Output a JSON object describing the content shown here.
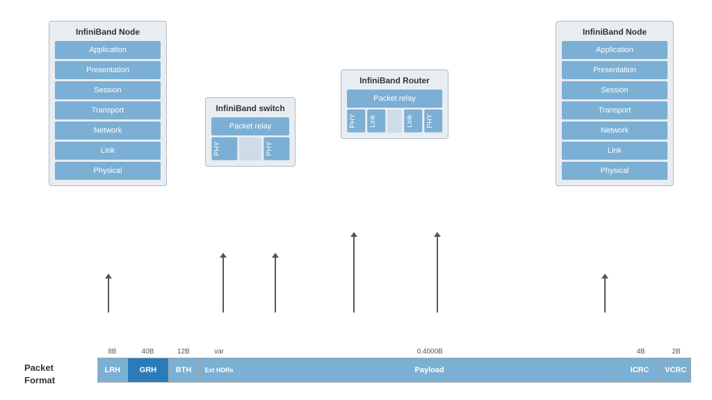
{
  "leftNode": {
    "title": "InfiniBand Node",
    "layers": [
      "Application",
      "Presentation",
      "Session",
      "Transport",
      "Network",
      "Link",
      "Physical"
    ]
  },
  "switch": {
    "title": "InfiniBand switch",
    "relayLabel": "Packet relay",
    "phyLabels": [
      "PHY",
      "PHY"
    ]
  },
  "router": {
    "title": "InfiniBand Router",
    "relayLabel": "Packet relay",
    "phyLabels": [
      "PHY",
      "PHY"
    ],
    "linkLabels": [
      "Link",
      "Link"
    ]
  },
  "rightNode": {
    "title": "InfiniBand Node",
    "layers": [
      "Application",
      "Presentation",
      "Session",
      "Transport",
      "Network",
      "Link",
      "Physical"
    ]
  },
  "packetFormat": {
    "label": "Packet\nFormat",
    "sizes": [
      "8B",
      "40B",
      "12B",
      "var",
      "0.4000B",
      "4B",
      "2B"
    ],
    "blocks": [
      {
        "label": "LRH",
        "type": "lrh",
        "width": "5%"
      },
      {
        "label": "GRH",
        "type": "grh",
        "width": "7%"
      },
      {
        "label": "BTH",
        "type": "bth",
        "width": "5%"
      },
      {
        "label": "Ext HDRs",
        "type": "ext",
        "width": "7%"
      },
      {
        "label": "Payload",
        "type": "payload",
        "width": "auto"
      },
      {
        "label": "ICRC",
        "type": "icrc",
        "width": "7%"
      },
      {
        "label": "VCRC",
        "type": "vcrc",
        "width": "5%"
      }
    ]
  }
}
